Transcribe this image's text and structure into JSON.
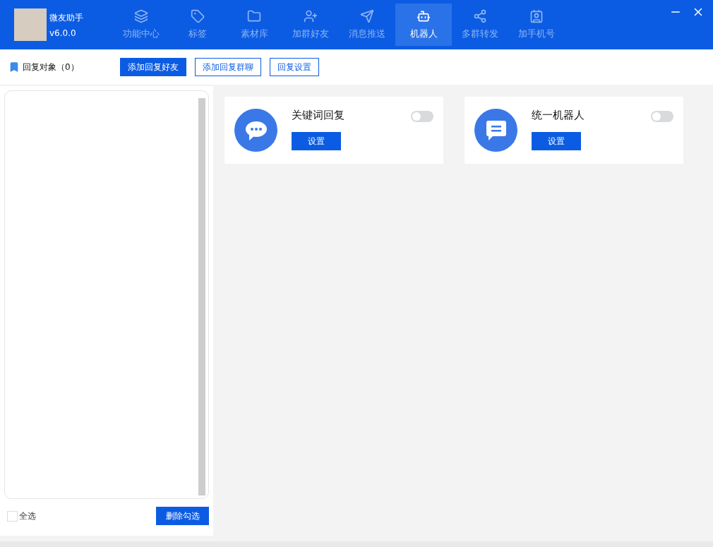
{
  "app": {
    "name": "微友助手",
    "version": "v6.0.0"
  },
  "nav": [
    {
      "label": "功能中心",
      "kind": "layers",
      "selected": false
    },
    {
      "label": "标签",
      "kind": "tag",
      "selected": false
    },
    {
      "label": "素材库",
      "kind": "folder",
      "selected": false
    },
    {
      "label": "加群好友",
      "kind": "user-plus",
      "selected": false
    },
    {
      "label": "消息推送",
      "kind": "send",
      "selected": false
    },
    {
      "label": "机器人",
      "kind": "bot",
      "selected": true
    },
    {
      "label": "多群转发",
      "kind": "share",
      "selected": false
    },
    {
      "label": "加手机号",
      "kind": "contact",
      "selected": false
    }
  ],
  "toolbar": {
    "title": "回复对象（0）",
    "buttons": [
      {
        "label": "添加回复好友",
        "kind": "primary"
      },
      {
        "label": "添加回复群聊",
        "kind": "outline"
      },
      {
        "label": "回复设置",
        "kind": "outline"
      }
    ]
  },
  "cards": [
    {
      "title": "关键词回复",
      "kind": "chat",
      "on": false,
      "button": "设置"
    },
    {
      "title": "统一机器人",
      "kind": "message",
      "on": false,
      "button": "设置"
    }
  ],
  "footer": {
    "select_all": {
      "label": "全选",
      "checked": false
    },
    "delete_button": "删除勾选"
  }
}
